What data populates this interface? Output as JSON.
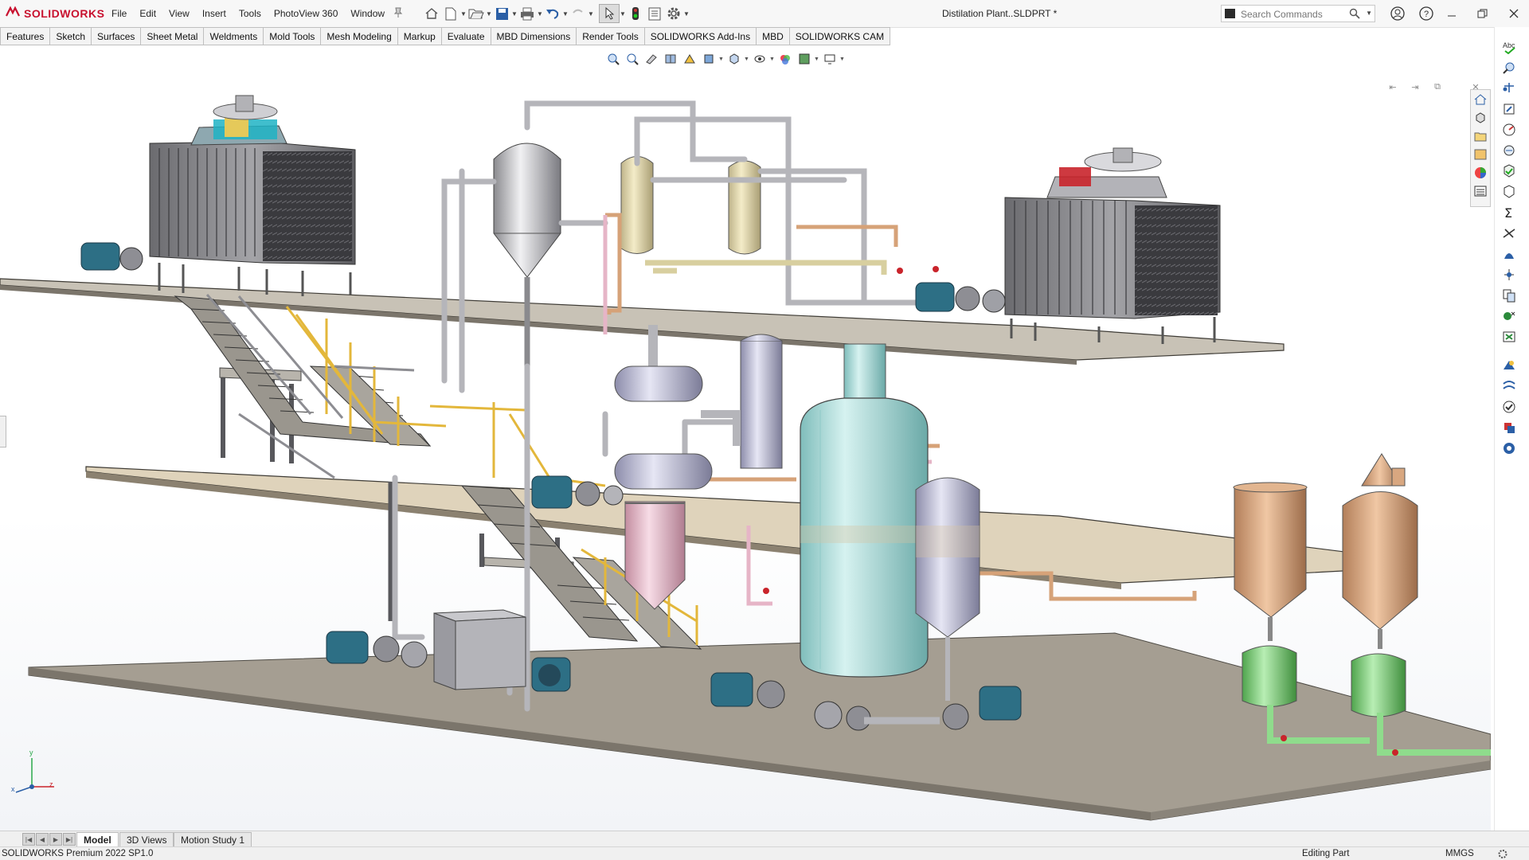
{
  "app": {
    "brand": "SOLIDWORKS",
    "document_title": "Distilation Plant..SLDPRT *"
  },
  "menu": [
    "File",
    "Edit",
    "View",
    "Insert",
    "Tools",
    "PhotoView 360",
    "Window"
  ],
  "search": {
    "placeholder": "Search Commands"
  },
  "command_tabs": [
    "Features",
    "Sketch",
    "Surfaces",
    "Sheet Metal",
    "Weldments",
    "Mold Tools",
    "Mesh Modeling",
    "Markup",
    "Evaluate",
    "MBD Dimensions",
    "Render Tools",
    "SOLIDWORKS Add-Ins",
    "MBD",
    "SOLIDWORKS CAM"
  ],
  "bottom_tabs": [
    "Model",
    "3D Views",
    "Motion Study 1"
  ],
  "status": {
    "product": "SOLIDWORKS Premium 2022 SP1.0",
    "mode": "Editing Part",
    "units": "MMGS"
  },
  "triad": {
    "x": "x",
    "y": "y",
    "z": "z"
  },
  "colors": {
    "brand_red": "#c8102e",
    "floor": "#a39c90",
    "platform": "#c9b99a",
    "tank_cyan": "#a7dcda",
    "steel": "#b9b9bc",
    "pump_blue": "#2d6f85",
    "rail_yellow": "#e3b73b",
    "green_tank": "#7ed07b",
    "copper": "#d6a278",
    "pink": "#e6b5c7"
  },
  "icons": [
    "solidworks-logo-icon",
    "home-icon",
    "new-document-icon",
    "open-icon",
    "save-icon",
    "print-icon",
    "undo-icon",
    "redo-icon",
    "select-icon",
    "traffic-light-icon",
    "file-properties-icon",
    "options-gear-icon",
    "search-icon",
    "user-icon",
    "help-icon",
    "restore-icon",
    "close-icon"
  ]
}
